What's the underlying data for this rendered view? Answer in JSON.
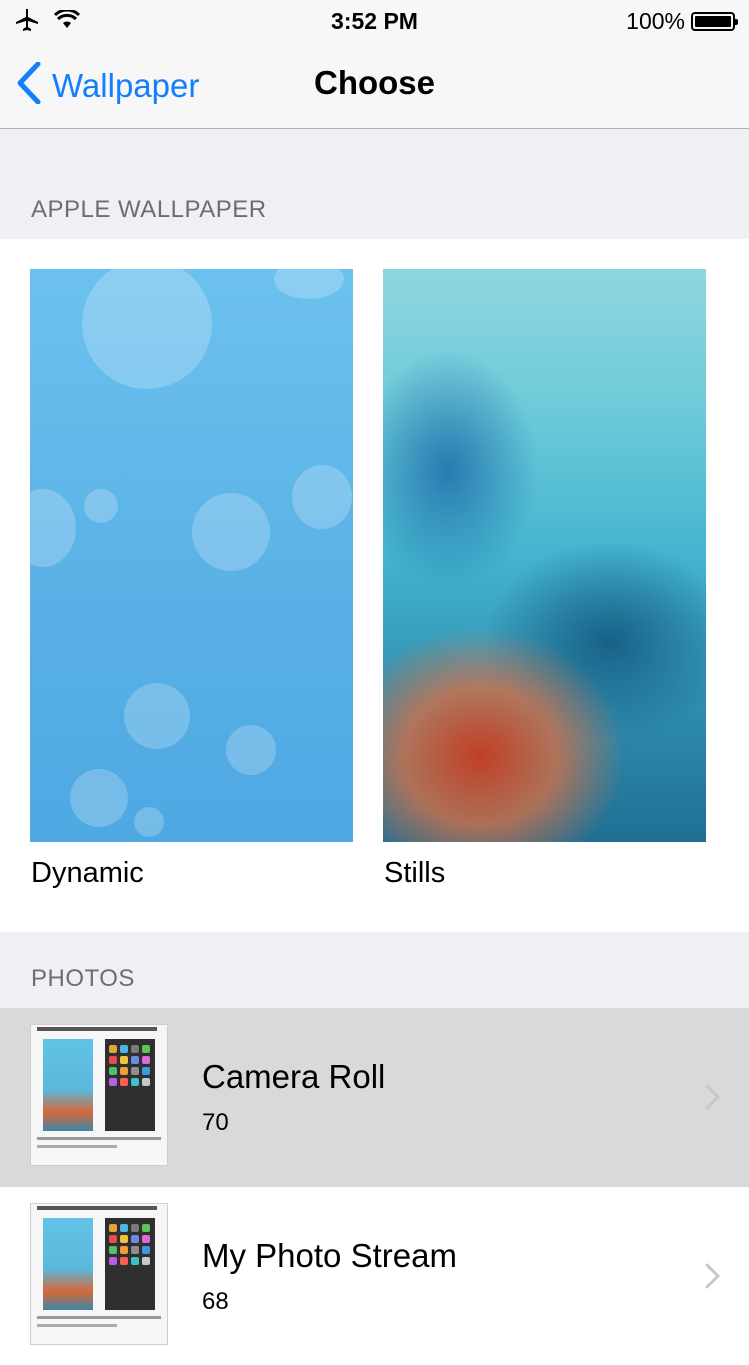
{
  "status_bar": {
    "time": "3:52 PM",
    "battery_text": "100%",
    "icons": [
      "airplane-icon",
      "wifi-icon",
      "battery-icon"
    ]
  },
  "nav": {
    "back_label": "Wallpaper",
    "title": "Choose"
  },
  "apple_wallpaper": {
    "header": "APPLE WALLPAPER",
    "items": [
      {
        "label": "Dynamic"
      },
      {
        "label": "Stills"
      }
    ]
  },
  "photos": {
    "header": "PHOTOS",
    "albums": [
      {
        "title": "Camera Roll",
        "count": "70",
        "selected": true
      },
      {
        "title": "My Photo Stream",
        "count": "68",
        "selected": false
      }
    ]
  },
  "colors": {
    "accent": "#147efb",
    "background": "#efeff4",
    "section_header": "#6d6d72",
    "selected_row": "#d9d9d9"
  }
}
